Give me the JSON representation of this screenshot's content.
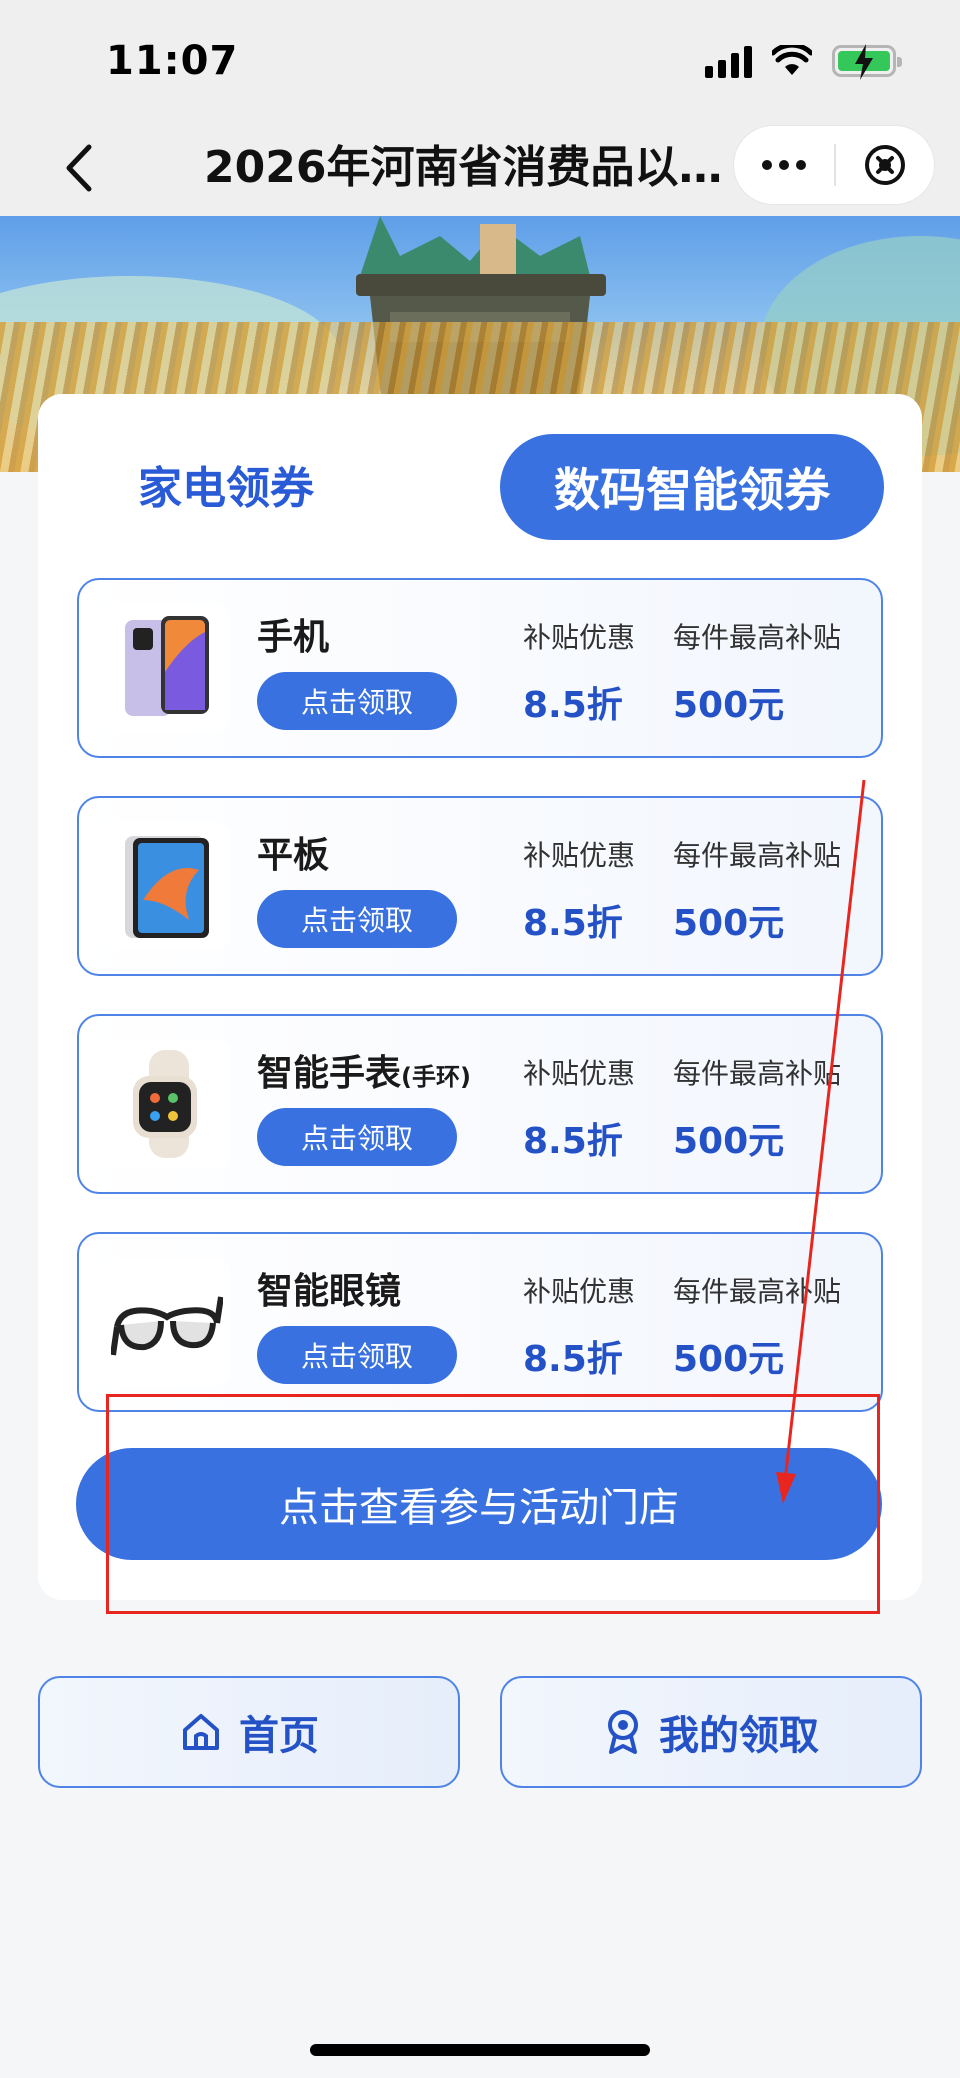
{
  "status_bar": {
    "time": "11:07"
  },
  "nav": {
    "title": "2026年河南省消费品以旧…",
    "back_icon": "chevron-left-icon",
    "more_icon": "more-dots-icon",
    "close_icon": "close-circle-icon"
  },
  "tabs": {
    "home_appliance": "家电领券",
    "digital": "数码智能领券",
    "active": "digital"
  },
  "products": [
    {
      "name": "手机",
      "name_suffix": "",
      "button": "点击领取",
      "discount_label": "补贴优惠",
      "discount_value": "8.5折",
      "max_label": "每件最高补贴",
      "max_value": "500元",
      "icon": "phone-icon"
    },
    {
      "name": "平板",
      "name_suffix": "",
      "button": "点击领取",
      "discount_label": "补贴优惠",
      "discount_value": "8.5折",
      "max_label": "每件最高补贴",
      "max_value": "500元",
      "icon": "tablet-icon"
    },
    {
      "name": "智能手表",
      "name_suffix": "(手环)",
      "button": "点击领取",
      "discount_label": "补贴优惠",
      "discount_value": "8.5折",
      "max_label": "每件最高补贴",
      "max_value": "500元",
      "icon": "smartwatch-icon"
    },
    {
      "name": "智能眼镜",
      "name_suffix": "",
      "button": "点击领取",
      "discount_label": "补贴优惠",
      "discount_value": "8.5折",
      "max_label": "每件最高补贴",
      "max_value": "500元",
      "icon": "smart-glasses-icon"
    }
  ],
  "store_button": "点击查看参与活动门店",
  "bottom_nav": {
    "home": "首页",
    "mine": "我的领取"
  },
  "colors": {
    "primary": "#3a71e0",
    "text_accent": "#2452c6",
    "annotation": "#e8261f"
  }
}
